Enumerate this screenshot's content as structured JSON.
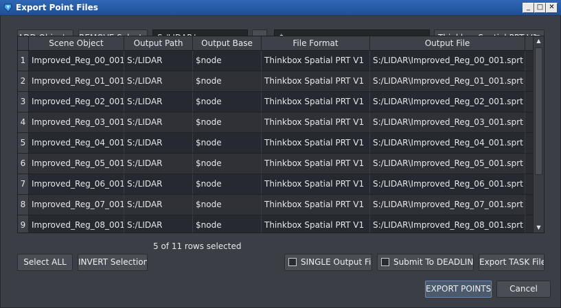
{
  "window": {
    "title": "Export Point Files",
    "controls": {
      "minimize": "_",
      "maximize": "□",
      "close": "✕"
    }
  },
  "toolbar": {
    "add_objects_label": "ADD Objects...",
    "remove_selected_label": "REMOVE Selected",
    "output_path_value": "S:/LIDAR/",
    "browse_label": "...",
    "output_base_value": "$source",
    "format_selected": "Thinkbox Spatial PRT V1"
  },
  "table": {
    "columns": [
      "Scene Object",
      "Output Path",
      "Output Base",
      "File Format",
      "Output File"
    ],
    "rows": [
      {
        "num": "1",
        "selected": true,
        "cells": [
          "Improved_Reg_00_001",
          "S:/LIDAR",
          "$node",
          "Thinkbox Spatial PRT V1",
          "S:/LIDAR\\Improved_Reg_00_001.sprt"
        ]
      },
      {
        "num": "2",
        "selected": false,
        "cells": [
          "Improved_Reg_01_001",
          "S:/LIDAR",
          "$node",
          "Thinkbox Spatial PRT V1",
          "S:/LIDAR\\Improved_Reg_01_001.sprt"
        ]
      },
      {
        "num": "3",
        "selected": true,
        "cells": [
          "Improved_Reg_02_001",
          "S:/LIDAR",
          "$node",
          "Thinkbox Spatial PRT V1",
          "S:/LIDAR\\Improved_Reg_02_001.sprt"
        ]
      },
      {
        "num": "4",
        "selected": false,
        "cells": [
          "Improved_Reg_03_001",
          "S:/LIDAR",
          "$node",
          "Thinkbox Spatial PRT V1",
          "S:/LIDAR\\Improved_Reg_03_001.sprt"
        ]
      },
      {
        "num": "5",
        "selected": true,
        "cells": [
          "Improved_Reg_04_001",
          "S:/LIDAR",
          "$node",
          "Thinkbox Spatial PRT V1",
          "S:/LIDAR\\Improved_Reg_04_001.sprt"
        ]
      },
      {
        "num": "6",
        "selected": false,
        "cells": [
          "Improved_Reg_05_001",
          "S:/LIDAR",
          "$node",
          "Thinkbox Spatial PRT V1",
          "S:/LIDAR\\Improved_Reg_05_001.sprt"
        ]
      },
      {
        "num": "7",
        "selected": true,
        "cells": [
          "Improved_Reg_06_001",
          "S:/LIDAR",
          "$node",
          "Thinkbox Spatial PRT V1",
          "S:/LIDAR\\Improved_Reg_06_001.sprt"
        ]
      },
      {
        "num": "8",
        "selected": false,
        "cells": [
          "Improved_Reg_07_001",
          "S:/LIDAR",
          "$node",
          "Thinkbox Spatial PRT V1",
          "S:/LIDAR\\Improved_Reg_07_001.sprt"
        ]
      },
      {
        "num": "9",
        "selected": true,
        "cells": [
          "Improved_Reg_08_001",
          "S:/LIDAR",
          "$node",
          "Thinkbox Spatial PRT V1",
          "S:/LIDAR\\Improved_Reg_08_001.sprt"
        ]
      }
    ]
  },
  "selection": {
    "select_all_label": "Select ALL",
    "invert_label": "INVERT Selection",
    "status_text": "5 of 11 rows selected"
  },
  "options": {
    "single_output_label": "SINGLE Output File",
    "single_output_checked": false,
    "deadline_label": "Submit To DEADLINE",
    "deadline_checked": false,
    "export_task_label": "Export TASK File"
  },
  "footer": {
    "export_label": "EXPORT POINTS",
    "cancel_label": "Cancel"
  },
  "colors": {
    "titlebar": "#2f67b6",
    "background": "#3b3e44",
    "table_bg": "#2a2c31",
    "accent": "#5d88c8"
  }
}
